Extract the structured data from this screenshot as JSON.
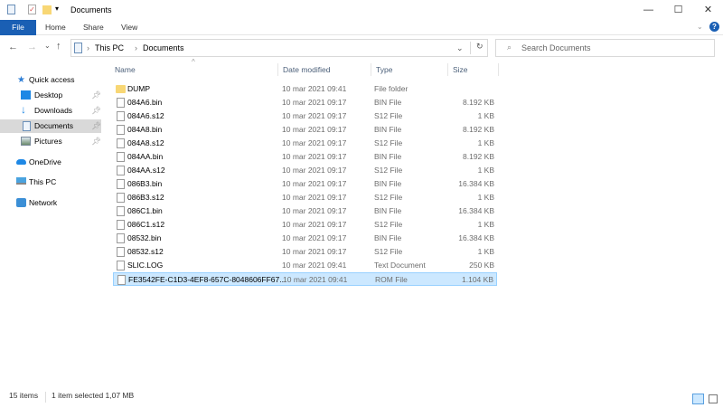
{
  "window": {
    "title": "Documents",
    "minimize": "—",
    "maximize": "☐",
    "close": "✕"
  },
  "ribbon": {
    "tabs": [
      "File",
      "Home",
      "Share",
      "View"
    ],
    "help": "?",
    "accent": "#1a5fb4"
  },
  "address": {
    "crumbs": [
      "This PC",
      "Documents"
    ],
    "search_placeholder": "Search Documents"
  },
  "sidebar": {
    "items": [
      {
        "label": "Quick access",
        "icon": "star-icon",
        "pinned": false
      },
      {
        "label": "Desktop",
        "icon": "desktop-icon",
        "pinned": true
      },
      {
        "label": "Downloads",
        "icon": "download-icon",
        "pinned": true
      },
      {
        "label": "Documents",
        "icon": "documents-icon",
        "pinned": true,
        "selected": true
      },
      {
        "label": "Pictures",
        "icon": "pictures-icon",
        "pinned": true
      },
      {
        "label": "OneDrive",
        "icon": "cloud-icon",
        "pinned": false
      },
      {
        "label": "This PC",
        "icon": "computer-icon",
        "pinned": false
      },
      {
        "label": "Network",
        "icon": "network-icon",
        "pinned": false
      }
    ]
  },
  "columns": [
    "Name",
    "Date modified",
    "Type",
    "Size"
  ],
  "files": [
    {
      "name": "DUMP",
      "date": "10 mar 2021 09:41",
      "type": "File folder",
      "size": "",
      "folder": true
    },
    {
      "name": "084A6.bin",
      "date": "10 mar 2021 09:17",
      "type": "BIN File",
      "size": "8.192 KB"
    },
    {
      "name": "084A6.s12",
      "date": "10 mar 2021 09:17",
      "type": "S12 File",
      "size": "1 KB"
    },
    {
      "name": "084A8.bin",
      "date": "10 mar 2021 09:17",
      "type": "BIN File",
      "size": "8.192 KB"
    },
    {
      "name": "084A8.s12",
      "date": "10 mar 2021 09:17",
      "type": "S12 File",
      "size": "1 KB"
    },
    {
      "name": "084AA.bin",
      "date": "10 mar 2021 09:17",
      "type": "BIN File",
      "size": "8.192 KB"
    },
    {
      "name": "084AA.s12",
      "date": "10 mar 2021 09:17",
      "type": "S12 File",
      "size": "1 KB"
    },
    {
      "name": "086B3.bin",
      "date": "10 mar 2021 09:17",
      "type": "BIN File",
      "size": "16.384 KB"
    },
    {
      "name": "086B3.s12",
      "date": "10 mar 2021 09:17",
      "type": "S12 File",
      "size": "1 KB"
    },
    {
      "name": "086C1.bin",
      "date": "10 mar 2021 09:17",
      "type": "BIN File",
      "size": "16.384 KB"
    },
    {
      "name": "086C1.s12",
      "date": "10 mar 2021 09:17",
      "type": "S12 File",
      "size": "1 KB"
    },
    {
      "name": "08532.bin",
      "date": "10 mar 2021 09:17",
      "type": "BIN File",
      "size": "16.384 KB"
    },
    {
      "name": "08532.s12",
      "date": "10 mar 2021 09:17",
      "type": "S12 File",
      "size": "1 KB"
    },
    {
      "name": "SLIC.LOG",
      "date": "10 mar 2021 09:41",
      "type": "Text Document",
      "size": "250 KB"
    },
    {
      "name": "FE3542FE-C1D3-4EF8-657C-8048606FF67...",
      "date": "10 mar 2021 09:41",
      "type": "ROM File",
      "size": "1.104 KB",
      "selected": true
    }
  ],
  "status": {
    "count": "15 items",
    "selection": "1 item selected  1,07 MB"
  }
}
